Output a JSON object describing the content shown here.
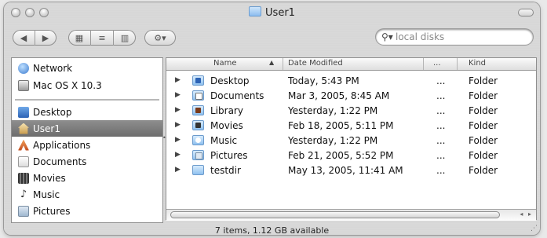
{
  "window": {
    "title": "User1"
  },
  "toolbar": {
    "nav_back": "◀",
    "nav_forward": "▶",
    "view_icons": "▦",
    "view_list": "≡",
    "view_columns": "▥",
    "action": "⚙▾"
  },
  "search": {
    "placeholder": "local disks"
  },
  "sidebar": {
    "items": [
      {
        "label": "Network"
      },
      {
        "label": "Mac OS X 10.3"
      },
      {
        "label": "Desktop"
      },
      {
        "label": "User1"
      },
      {
        "label": "Applications"
      },
      {
        "label": "Documents"
      },
      {
        "label": "Movies"
      },
      {
        "label": "Music"
      },
      {
        "label": "Pictures"
      }
    ]
  },
  "list": {
    "columns": {
      "name": "Name",
      "date": "Date Modified",
      "size": "...",
      "kind": "Kind"
    },
    "rows": [
      {
        "name": "Desktop",
        "date": "Today, 5:43 PM",
        "size": "...",
        "kind": "Folder"
      },
      {
        "name": "Documents",
        "date": "Mar 3, 2005, 8:45 AM",
        "size": "...",
        "kind": "Folder"
      },
      {
        "name": "Library",
        "date": "Yesterday, 1:22 PM",
        "size": "...",
        "kind": "Folder"
      },
      {
        "name": "Movies",
        "date": "Feb 18, 2005, 5:11 PM",
        "size": "...",
        "kind": "Folder"
      },
      {
        "name": "Music",
        "date": "Yesterday, 1:22 PM",
        "size": "...",
        "kind": "Folder"
      },
      {
        "name": "Pictures",
        "date": "Feb 21, 2005, 5:52 PM",
        "size": "...",
        "kind": "Folder"
      },
      {
        "name": "testdir",
        "date": "May 13, 2005, 11:41 AM",
        "size": "...",
        "kind": "Folder"
      }
    ]
  },
  "status": {
    "text": "7 items, 1.12 GB available"
  },
  "colors": {
    "selection": "#7a7a7a",
    "folder_blue": "#8ec0ef"
  }
}
